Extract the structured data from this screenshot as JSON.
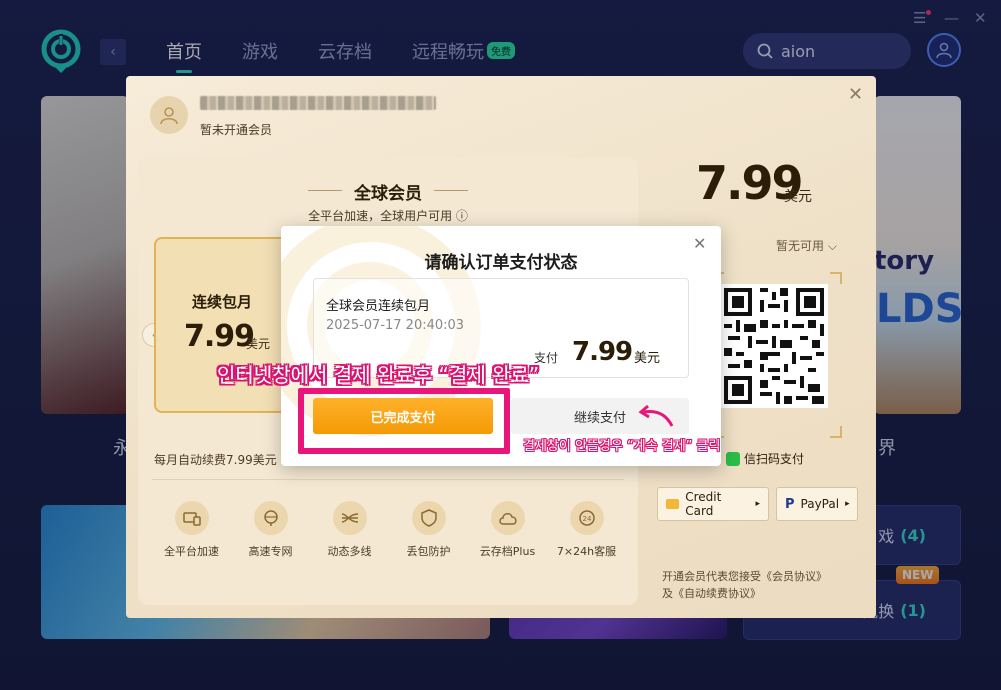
{
  "topbar": {
    "nav": [
      {
        "label": "首页",
        "active": true
      },
      {
        "label": "游戏",
        "active": false
      },
      {
        "label": "云存档",
        "active": false
      },
      {
        "label": "远程畅玩",
        "active": false,
        "badge": "免费"
      }
    ],
    "search": {
      "value": "aion"
    }
  },
  "background": {
    "left_caption": "永",
    "right_caption": "界",
    "right_card_text1": "tory",
    "right_card_text2": "LDS",
    "side_boxes": [
      {
        "label": "戏",
        "count": "(4)"
      },
      {
        "label": "兑换",
        "count": "(1)",
        "badge": "NEW"
      }
    ]
  },
  "panel": {
    "user_status": "暂未开通会员",
    "plan": {
      "title": "全球会员",
      "subtitle": "全平台加速，全球用户可用 ⓘ",
      "card_name": "连续包月",
      "card_price": "7.99",
      "card_unit": "美元",
      "renew_note": "每月自动续费7.99美元"
    },
    "features": [
      {
        "icon": "devices-icon",
        "label": "全平台加速"
      },
      {
        "icon": "globe-icon",
        "label": "高速专网"
      },
      {
        "icon": "multiline-icon",
        "label": "动态多线"
      },
      {
        "icon": "shield-icon",
        "label": "丢包防护"
      },
      {
        "icon": "cloud-icon",
        "label": "云存档Plus"
      },
      {
        "icon": "support-24h-icon",
        "label": "7×24h客服"
      }
    ],
    "price": "7.99",
    "price_unit": "美元",
    "coupon": "暂无可用",
    "wechat_label": "微信扫码支付",
    "wechat_visible": "信扫码支付",
    "pay_methods": [
      "Credit Card",
      "PayPal"
    ],
    "agreement": [
      "开通会员代表您接受《会员协议》",
      "及《自动续费协议》"
    ]
  },
  "dialog": {
    "title": "请确认订单支付状态",
    "order_name": "全球会员连续包月",
    "order_time": "2025-07-17 20:40:03",
    "pay_label": "支付",
    "price": "7.99",
    "unit": "美元",
    "done_button": "已完成支付",
    "continue_button": "继续支付"
  },
  "annotations": {
    "main": "인터넷창에서 결제 완료후 “결제 완료”",
    "secondary": "결제창이 안뜰경우 “계속 결제” 클릭"
  },
  "colors": {
    "accent": "#2ee6c9",
    "highlight": "#e8167a",
    "primary_button": "#f59a05"
  }
}
